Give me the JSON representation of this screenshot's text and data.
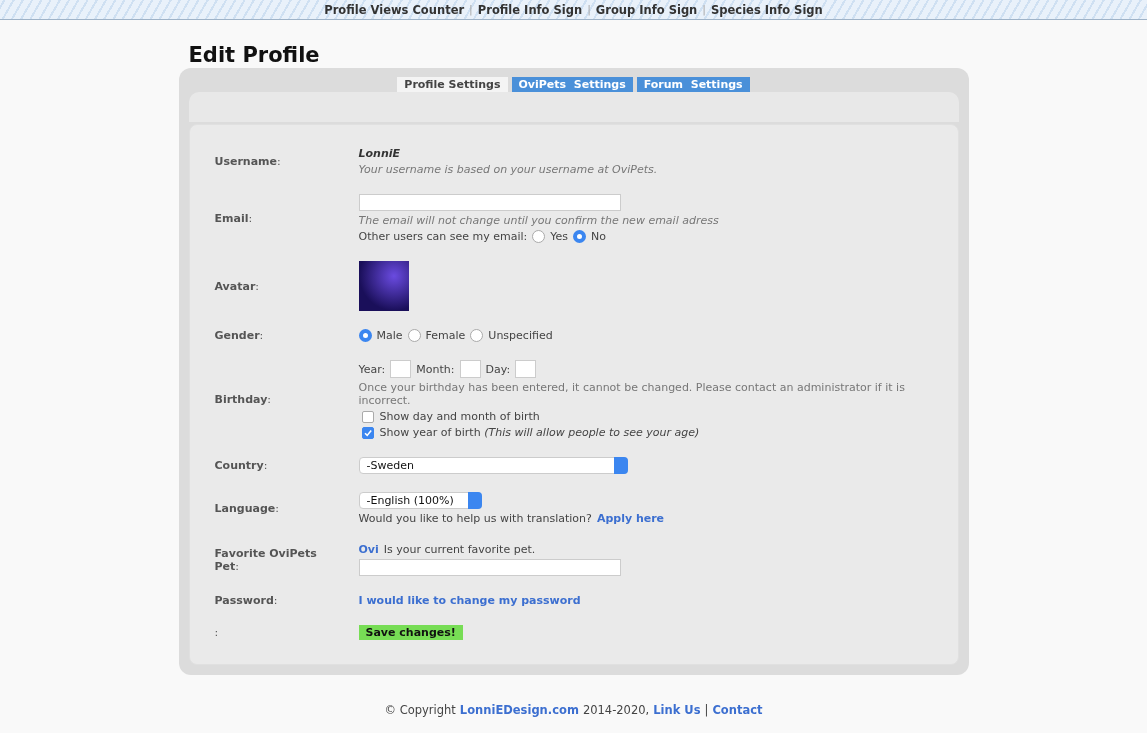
{
  "top_nav": {
    "links": [
      "Profile Views Counter",
      "Profile Info Sign",
      "Group Info Sign",
      "Species Info Sign"
    ],
    "separator": "|"
  },
  "page_title": "Edit Profile",
  "tabs": [
    {
      "label": "Profile Settings",
      "selected": true
    },
    {
      "label": "OviPets  Settings",
      "selected": false
    },
    {
      "label": "Forum  Settings",
      "selected": false
    }
  ],
  "form": {
    "username": {
      "label": "**Username**:",
      "value": "LonniE",
      "note": "Your username is based on your username at OviPets."
    },
    "email": {
      "label": "**Email**:",
      "note": "The email will not change until you confirm the new email adress",
      "visibility_label": "Other users can see my email:",
      "options": [
        {
          "label": "Yes",
          "selected": false
        },
        {
          "label": "No",
          "selected": true
        }
      ]
    },
    "avatar": {
      "label": "**Avatar**:"
    },
    "gender": {
      "label": "**Gender**:",
      "options": [
        {
          "label": "Male",
          "selected": true
        },
        {
          "label": "Female",
          "selected": false
        },
        {
          "label": "Unspecified",
          "selected": false
        }
      ]
    },
    "birthday": {
      "label": "**Birthday**:",
      "year_label": "Year:",
      "month_label": "Month:",
      "day_label": "Day:",
      "note": "Once your birthday has been entered, it cannot be changed. Please contact an administrator if it is incorrect.",
      "checkboxes": [
        {
          "label": "Show day and month of birth",
          "checked": false
        },
        {
          "label": "Show year of birth *(This will allow people to see your age)*",
          "checked": true
        }
      ]
    },
    "country": {
      "label": "**Country**:",
      "value": "-Sweden"
    },
    "language": {
      "label": "**Language**:",
      "value": "-English (100%)",
      "prompt": "Would you like to help us with translation?",
      "link": "Apply here"
    },
    "favorite_pet": {
      "label": "**Favorite OviPets Pet**:",
      "pet_link": "Ovi",
      "note": "Is your current favorite pet."
    },
    "password": {
      "label": "**Password**:",
      "link": "I would like to change my password"
    },
    "save": {
      "label": ":",
      "button": "Save changes!"
    }
  },
  "footer": {
    "copyright": "© Copyright",
    "site_link": "LonniEDesign.com",
    "years": "2014-2020,",
    "link_us": "Link Us",
    "separator": "|",
    "contact": "Contact"
  }
}
